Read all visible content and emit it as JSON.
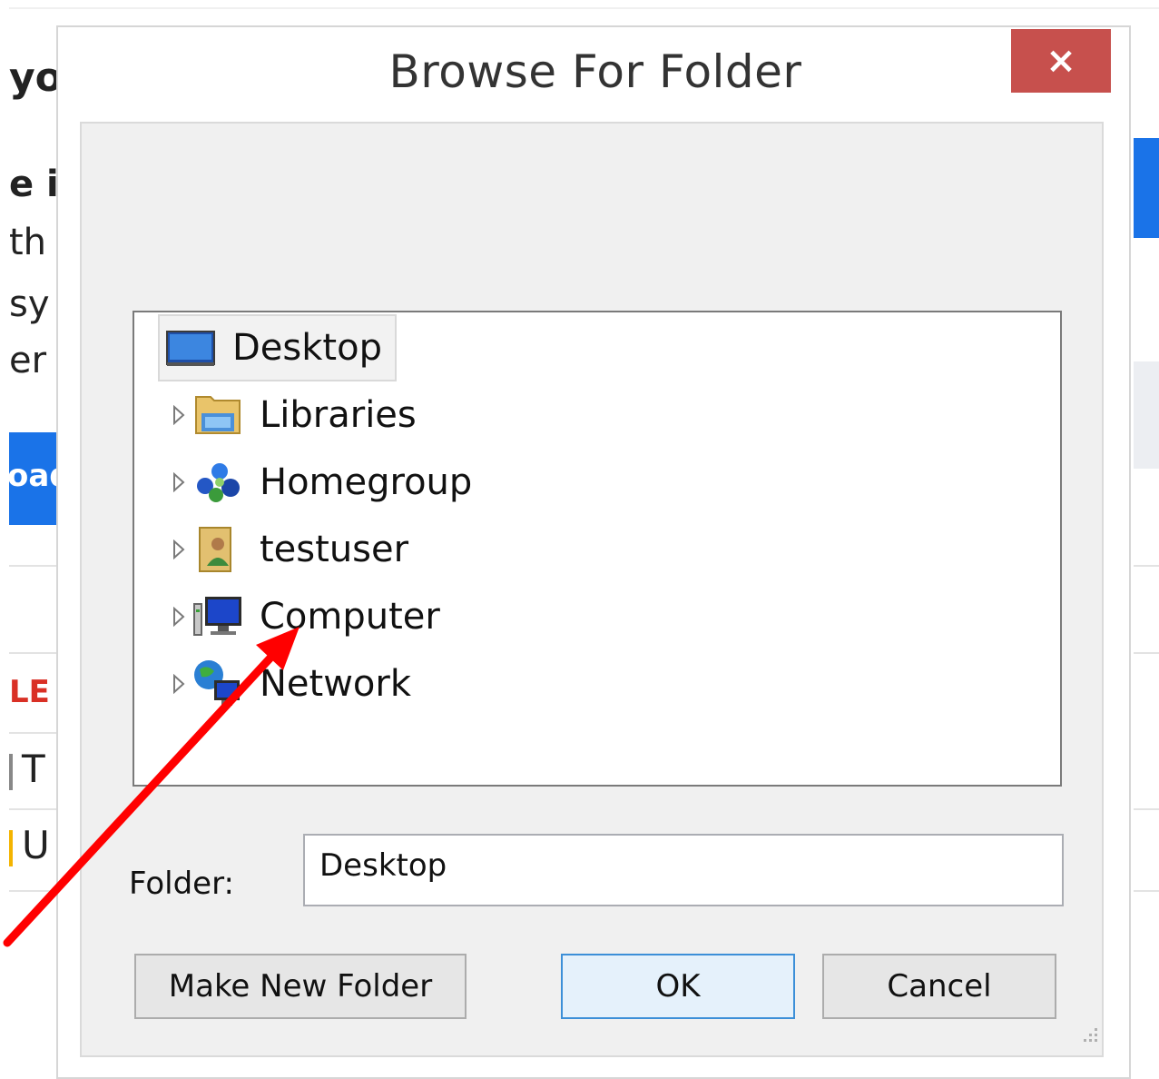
{
  "background_page": {
    "fragments": [
      "yo",
      "e i",
      "th",
      "sy",
      "er t",
      "LE",
      "T",
      "U"
    ],
    "button_fragment": "oad"
  },
  "dialog": {
    "title": "Browse For Folder",
    "close_label": "×",
    "tree": {
      "items": [
        {
          "label": "Desktop",
          "icon": "desktop-icon",
          "selected": true
        },
        {
          "label": "Libraries",
          "icon": "libraries-icon"
        },
        {
          "label": "Homegroup",
          "icon": "homegroup-icon"
        },
        {
          "label": "testuser",
          "icon": "user-folder-icon"
        },
        {
          "label": "Computer",
          "icon": "computer-icon"
        },
        {
          "label": "Network",
          "icon": "network-icon"
        }
      ]
    },
    "folder": {
      "label": "Folder:",
      "value": "Desktop"
    },
    "buttons": {
      "make_new_folder": "Make New Folder",
      "ok": "OK",
      "cancel": "Cancel"
    }
  },
  "colors": {
    "close_button": "#c7504d",
    "annotation_arrow": "#ff0000",
    "default_button_border": "#3c8fd8"
  }
}
